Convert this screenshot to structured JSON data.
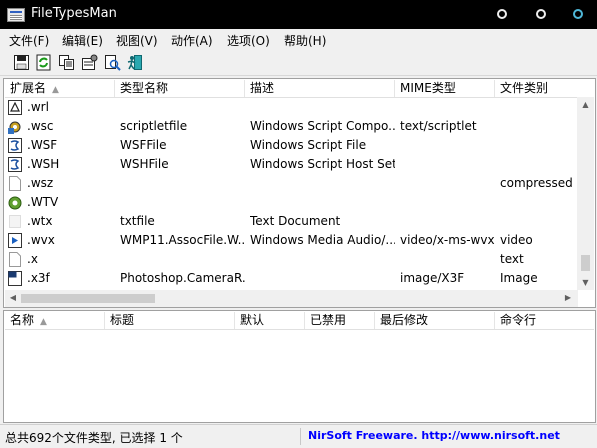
{
  "window": {
    "title": "FileTypesMan"
  },
  "menu": [
    "文件(F)",
    "编辑(E)",
    "视图(V)",
    "动作(A)",
    "选项(O)",
    "帮助(H)"
  ],
  "toolbar": [
    "save-icon",
    "refresh-icon",
    "copy-icon",
    "properties-icon",
    "find-icon",
    "exit-icon"
  ],
  "top_table": {
    "columns": [
      "扩展名",
      "类型名称",
      "描述",
      "MIME类型",
      "文件类别"
    ],
    "rows": [
      {
        "ext": ".wrl",
        "type": "",
        "desc": "",
        "mime": "",
        "cat": "",
        "icon": "vrml-file-icon"
      },
      {
        "ext": ".wsc",
        "type": "scriptletfile",
        "desc": "Windows Script Compo...",
        "mime": "text/scriptlet",
        "cat": "",
        "icon": "script-component-icon"
      },
      {
        "ext": ".WSF",
        "type": "WSFFile",
        "desc": "Windows Script File",
        "mime": "",
        "cat": "",
        "icon": "script-file-icon"
      },
      {
        "ext": ".WSH",
        "type": "WSHFile",
        "desc": "Windows Script Host Set...",
        "mime": "",
        "cat": "",
        "icon": "script-host-icon"
      },
      {
        "ext": ".wsz",
        "type": "",
        "desc": "",
        "mime": "",
        "cat": "compressed",
        "icon": "blank-file-icon"
      },
      {
        "ext": ".WTV",
        "type": "",
        "desc": "",
        "mime": "",
        "cat": "",
        "icon": "media-file-icon"
      },
      {
        "ext": ".wtx",
        "type": "txtfile",
        "desc": "Text Document",
        "mime": "",
        "cat": "",
        "icon": "text-file-icon"
      },
      {
        "ext": ".wvx",
        "type": "WMP11.AssocFile.W...",
        "desc": "Windows Media Audio/...",
        "mime": "video/x-ms-wvx",
        "cat": "video",
        "icon": "media-playlist-icon"
      },
      {
        "ext": ".x",
        "type": "",
        "desc": "",
        "mime": "",
        "cat": "text",
        "icon": "blank-file-icon"
      },
      {
        "ext": ".x3f",
        "type": "Photoshop.CameraR...",
        "desc": "",
        "mime": "image/X3F",
        "cat": "Image",
        "icon": "photoshop-file-icon"
      }
    ]
  },
  "bottom_table": {
    "columns": [
      "名称",
      "标题",
      "默认",
      "已禁用",
      "最后修改",
      "命令行"
    ]
  },
  "status": {
    "count": "总共692个文件类型, 已选择 1 个",
    "link": "NirSoft Freeware.  http://www.nirsoft.net"
  }
}
